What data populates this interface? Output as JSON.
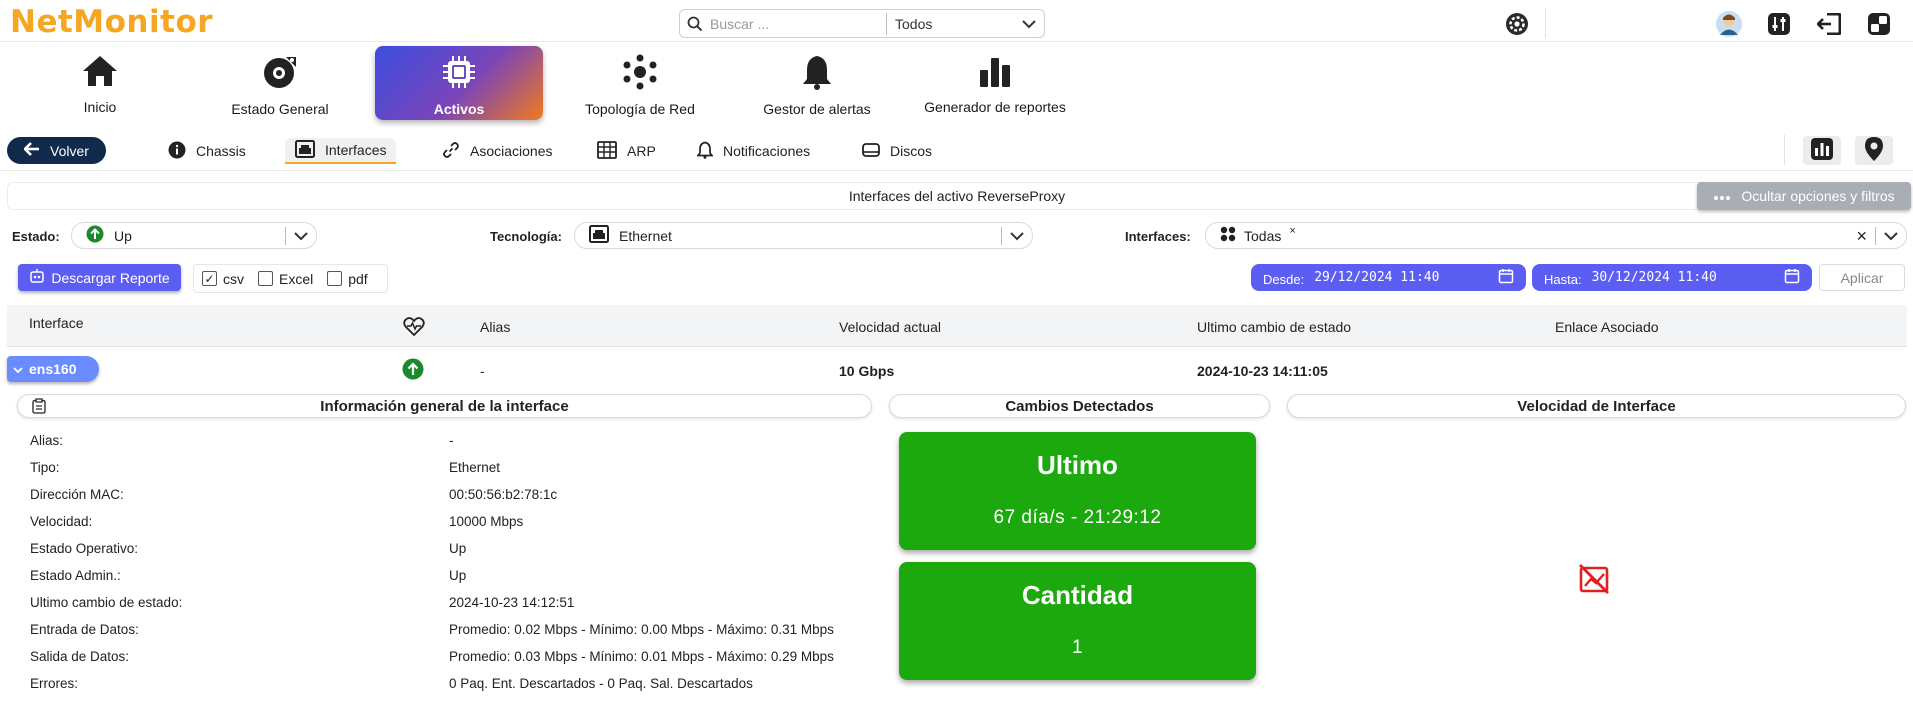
{
  "app": {
    "name": "NetMonitor"
  },
  "search": {
    "placeholder": "Buscar ...",
    "scope": "Todos"
  },
  "main_nav": [
    {
      "label": "Inicio",
      "icon": "home-icon"
    },
    {
      "label": "Estado General",
      "icon": "gauge-icon"
    },
    {
      "label": "Activos",
      "icon": "chip-icon",
      "active": true
    },
    {
      "label": "Topología de Red",
      "icon": "topology-icon"
    },
    {
      "label": "Gestor de alertas",
      "icon": "bell-icon"
    },
    {
      "label": "Generador de reportes",
      "icon": "bar-chart-icon"
    }
  ],
  "subnav": {
    "back": "Volver",
    "tabs": [
      {
        "label": "Chassis",
        "icon": "info-icon"
      },
      {
        "label": "Interfaces",
        "icon": "ethernet-icon",
        "active": true
      },
      {
        "label": "Asociaciones",
        "icon": "link-icon"
      },
      {
        "label": "ARP",
        "icon": "table-icon"
      },
      {
        "label": "Notificaciones",
        "icon": "bell-icon"
      },
      {
        "label": "Discos",
        "icon": "disk-icon"
      }
    ]
  },
  "title": "Interfaces del activo ReverseProxy",
  "toggle_filters": "Ocultar opciones y filtros",
  "filters": {
    "estado_label": "Estado:",
    "estado_value": "Up",
    "tecnologia_label": "Tecnología:",
    "tecnologia_value": "Ethernet",
    "interfaces_label": "Interfaces:",
    "interfaces_value": "Todas"
  },
  "report": {
    "download": "Descargar Reporte",
    "formats": [
      {
        "label": "csv",
        "checked": true
      },
      {
        "label": "Excel",
        "checked": false
      },
      {
        "label": "pdf",
        "checked": false
      }
    ],
    "desde_label": "Desde:",
    "desde_value": "29/12/2024 11:40",
    "hasta_label": "Hasta:",
    "hasta_value": "30/12/2024 11:40",
    "apply": "Aplicar"
  },
  "table": {
    "columns": [
      "Interface",
      "Alias",
      "Velocidad actual",
      "Ultimo cambio de estado",
      "Enlace Asociado"
    ],
    "rows": [
      {
        "interface": "ens160",
        "status": "up",
        "alias": "-",
        "velocidad": "10 Gbps",
        "ultimo_cambio": "2024-10-23 14:11:05",
        "enlace": ""
      }
    ]
  },
  "detail": {
    "info_title": "Información general de la interface",
    "changes_title": "Cambios Detectados",
    "speed_title": "Velocidad de Interface",
    "info": [
      {
        "key": "Alias:",
        "value": "-"
      },
      {
        "key": "Tipo:",
        "value": "Ethernet"
      },
      {
        "key": "Dirección MAC:",
        "value": "00:50:56:b2:78:1c"
      },
      {
        "key": "Velocidad:",
        "value": "10000 Mbps"
      },
      {
        "key": "Estado Operativo:",
        "value": "Up"
      },
      {
        "key": "Estado Admin.:",
        "value": "Up"
      },
      {
        "key": "Ultimo cambio de estado:",
        "value": "2024-10-23 14:12:51"
      },
      {
        "key": "Entrada de Datos:",
        "value": "Promedio: 0.02 Mbps - Mínimo: 0.00 Mbps - Máximo: 0.31 Mbps"
      },
      {
        "key": "Salida de Datos:",
        "value": "Promedio: 0.03 Mbps - Mínimo: 0.01 Mbps - Máximo: 0.29 Mbps"
      },
      {
        "key": "Errores:",
        "value": "0 Paq. Ent. Descartados - 0 Paq. Sal. Descartados"
      }
    ],
    "cards": [
      {
        "title": "Ultimo",
        "value": "67 día/s - 21:29:12"
      },
      {
        "title": "Cantidad",
        "value": "1"
      }
    ]
  },
  "colors": {
    "brand": "#f5a623",
    "primary": "#5b5ef0",
    "success": "#1ca90e",
    "status_up": "#1a8a2a",
    "no_data": "#e02020"
  }
}
